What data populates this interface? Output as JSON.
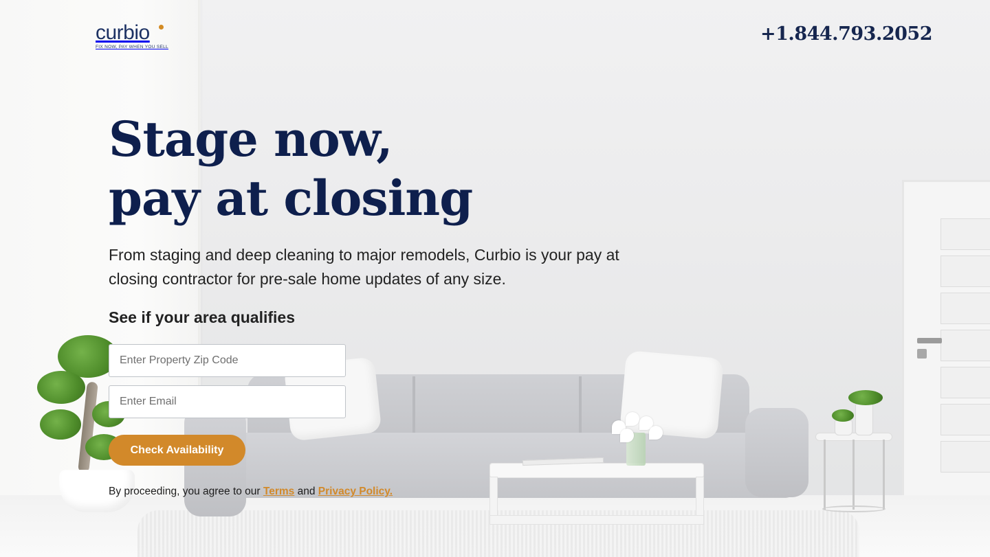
{
  "header": {
    "logo_text": "curbio",
    "logo_tagline": "FIX NOW, PAY WHEN YOU SELL",
    "phone": "+1.844.793.2052"
  },
  "hero": {
    "title_line1": "Stage now,",
    "title_line2": "pay at closing",
    "description": "From staging and deep cleaning to major remodels, Curbio is your pay at closing contractor for pre-sale home updates of any size.",
    "qualify_heading": "See if your area qualifies"
  },
  "form": {
    "zip_placeholder": "Enter Property Zip Code",
    "zip_value": "",
    "email_placeholder": "Enter Email",
    "email_value": "",
    "submit_label": "Check Availability"
  },
  "legal": {
    "prefix": "By proceeding, you agree to our",
    "terms_label": "Terms",
    "conjunction": "and",
    "privacy_label": "Privacy Policy",
    "suffix": "."
  },
  "colors": {
    "navy": "#0e1f4d",
    "accent_orange": "#d2892a",
    "logo_blue": "#1d3264"
  },
  "background_image": "living-room-photo"
}
